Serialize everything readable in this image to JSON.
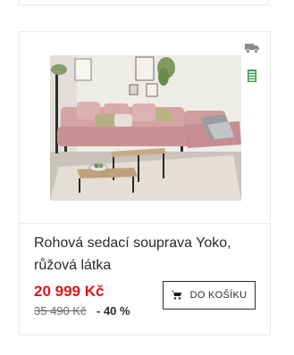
{
  "product": {
    "title_line1": "Rohová sedací souprava Yoko,",
    "title_line2": "růžová látka",
    "price": "20 999 Kč",
    "old_price": "35 490 Kč",
    "discount": "- 40 %",
    "image_icon": "pink-corner-sofa-photo"
  },
  "badges": {
    "delivery_icon": "truck-icon",
    "stock_icon": "in-stock-icon"
  },
  "cart": {
    "label": "DO KOŠÍKU",
    "icon": "shopping-cart-icon"
  },
  "colors": {
    "price": "#e0141b",
    "text": "#2b2b2b",
    "stock": "#3aa14a",
    "border": "#e9e9e9"
  }
}
